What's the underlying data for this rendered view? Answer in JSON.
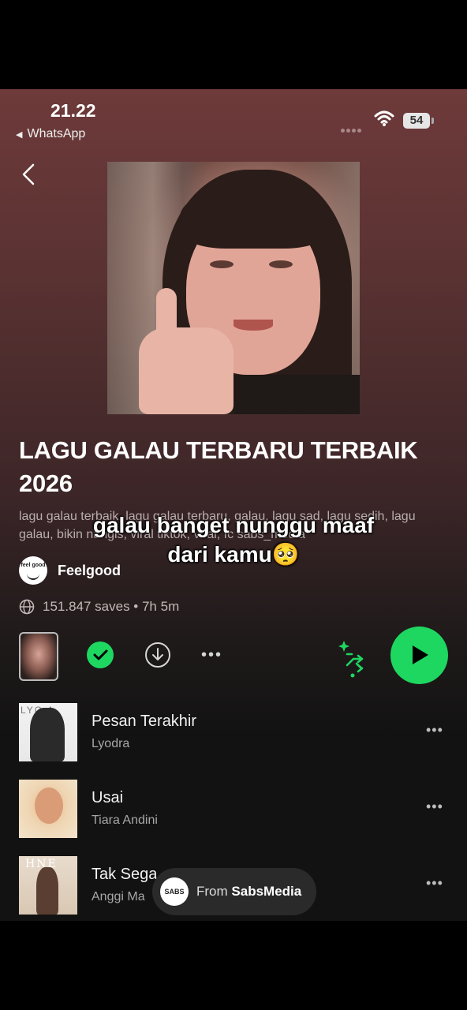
{
  "status_bar": {
    "time": "21.22",
    "back_app": "WhatsApp",
    "battery": "54"
  },
  "playlist": {
    "title": "LAGU GALAU TERBARU TERBAIK 2026",
    "description": "lagu galau terbaik, lagu galau terbaru, galau, lagu sad, lagu sedih, lagu galau, bikin nangis, viral tiktok, viral, fc sabs_media",
    "owner_logo_text": "feel good",
    "owner_name": "Feelgood",
    "meta": "151.847 saves • 7h 5m"
  },
  "caption": {
    "line1": "galau banget nunggu maaf",
    "line2": "dari kamu🥺"
  },
  "tracks": [
    {
      "title": "Pesan Terakhir",
      "artist": "Lyodra",
      "art_label": "LYO  A"
    },
    {
      "title": "Usai",
      "artist": "Tiara Andini",
      "art_label": ""
    },
    {
      "title": "Tak Sega",
      "artist": "Anggi Ma",
      "art_label": "HNE"
    }
  ],
  "from_pill": {
    "logo_text": "SABS",
    "prefix": "From",
    "source": "SabsMedia"
  },
  "colors": {
    "accent_green": "#1ed760",
    "background_dark": "#121212",
    "header_tint": "#6e3a3a"
  },
  "icons": [
    "chevron-left-icon",
    "wifi-icon",
    "globe-icon",
    "check-icon",
    "download-icon",
    "more-icon",
    "smart-shuffle-icon",
    "play-icon"
  ]
}
